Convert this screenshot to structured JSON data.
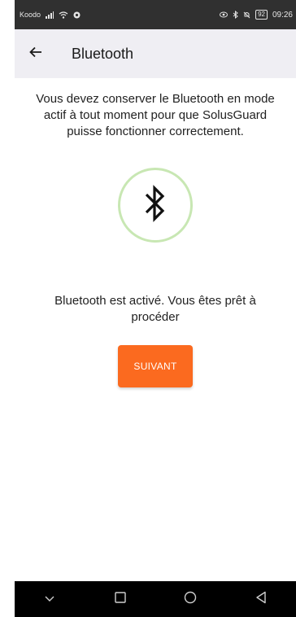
{
  "status_bar": {
    "carrier": "Koodo",
    "battery": "92",
    "time": "09:26"
  },
  "app_bar": {
    "title": "Bluetooth"
  },
  "content": {
    "intro": "Vous devez conserver le Bluetooth en mode actif à tout moment pour que SolusGuard puisse fonctionner correctement.",
    "status": "Bluetooth est activé. Vous êtes prêt à procéder",
    "next_label": "SUIVANT"
  },
  "icons": {
    "back": "arrow-left-icon",
    "bluetooth": "bluetooth-icon",
    "nav_down": "chevron-down-icon",
    "nav_square": "square-icon",
    "nav_circle": "circle-icon",
    "nav_back": "triangle-back-icon"
  },
  "colors": {
    "accent": "#fb6a1f",
    "circle_border": "#c8e7b3",
    "app_bar_bg": "#efeef3",
    "status_bar_bg": "#303030"
  }
}
